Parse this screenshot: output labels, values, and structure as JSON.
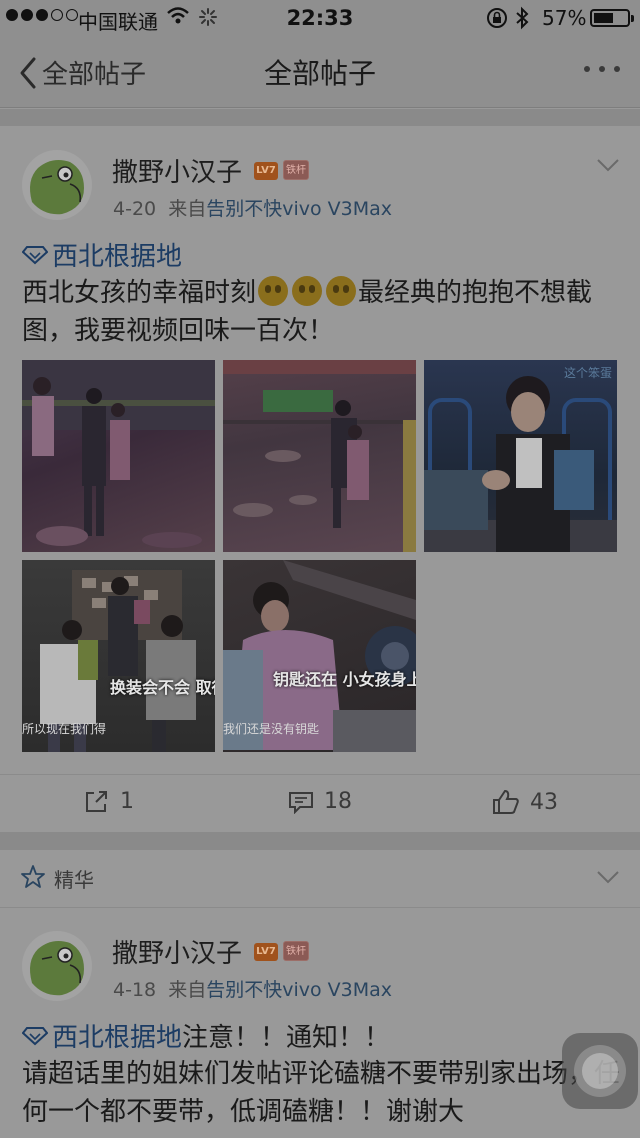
{
  "status_bar": {
    "carrier": "中国联通",
    "time": "22:33",
    "battery_percent": "57%"
  },
  "nav": {
    "back_label": "全部帖子",
    "title": "全部帖子"
  },
  "posts": [
    {
      "author": "撒野小汉子",
      "level_badge": "LV7",
      "rank_badge": "铁杆",
      "date": "4-20",
      "source_prefix": "来自",
      "source": "告别不快vivo V3Max",
      "topic": "西北根据地",
      "text_before": "西北女孩的幸福时刻",
      "text_after": "最经典的抱抱不想截图，我要视频回味一百次！",
      "images": [
        {
          "caption": ""
        },
        {
          "caption": ""
        },
        {
          "caption": "这个笨蛋"
        },
        {
          "caption": "换装会不会 取得密码提示",
          "caption2": "所以现在我们得"
        },
        {
          "caption": "钥匙还在 小女孩身上",
          "caption2": "我们还是没有钥匙"
        }
      ],
      "shares": "1",
      "comments": "18",
      "likes": "43"
    },
    {
      "author": "撒野小汉子",
      "level_badge": "LV7",
      "rank_badge": "铁杆",
      "date": "4-18",
      "source_prefix": "来自",
      "source": "告别不快vivo V3Max",
      "topic": "西北根据地",
      "topic_suffix": "注意！！通知！！",
      "text": "请超话里的姐妹们发帖评论磕糖不要带别家出场，任何一个都不要带，低调磕糖！！谢谢大"
    }
  ],
  "featured_label": "精华",
  "colors": {
    "topic_blue": "#1c3c64",
    "badge_orange": "#a0521c",
    "overlay_gray": "#999999"
  }
}
